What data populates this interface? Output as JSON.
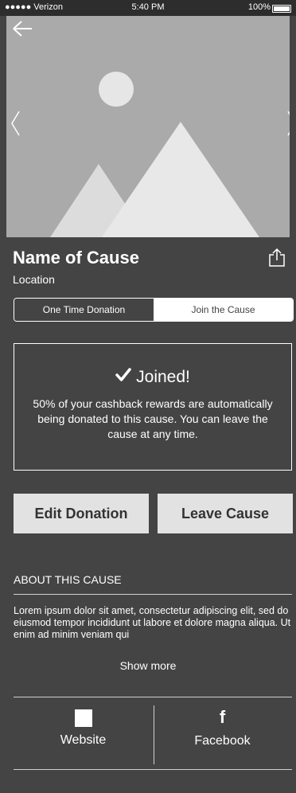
{
  "status_bar": {
    "carrier": "●●●●● Verizon",
    "time": "5:40 PM",
    "battery": "100%"
  },
  "hero": {
    "image_icon": "image-placeholder-icon",
    "back_icon": "arrow-left-icon",
    "prev_icon": "chevron-left-icon",
    "next_icon": "chevron-right-icon"
  },
  "cause": {
    "name": "Name of Cause",
    "location": "Location",
    "share_icon": "share-icon"
  },
  "tabs": [
    {
      "label": "One Time Donation",
      "selected": false
    },
    {
      "label": "Join the Cause",
      "selected": true
    }
  ],
  "joined": {
    "check_icon": "checkmark-icon",
    "heading": "Joined!",
    "message": "50% of your cashback rewards are automatically being donated to this cause. You can leave the cause at any time."
  },
  "actions": {
    "edit_label": "Edit Donation",
    "leave_label": "Leave Cause"
  },
  "about": {
    "heading": "ABOUT THIS CAUSE",
    "text": "Lorem ipsum dolor sit amet, consectetur adipiscing elit, sed do eiusmod tempor incididunt ut labore et dolore magna aliqua. Ut enim ad minim veniam qui",
    "show_more": "Show more"
  },
  "links": {
    "website_label": "Website",
    "website_icon": "website-icon",
    "facebook_label": "Facebook",
    "facebook_icon": "facebook-icon",
    "facebook_glyph": "f"
  },
  "colors": {
    "background": "#444444",
    "hero_placeholder": "#aaaaaa",
    "button": "#e2e2e2"
  }
}
